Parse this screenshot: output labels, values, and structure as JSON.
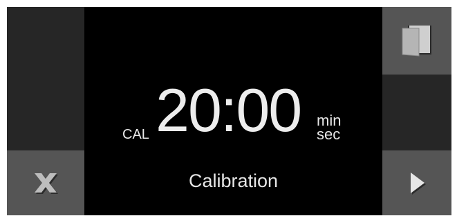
{
  "timer": {
    "prefix": "CAL",
    "value": "20:00",
    "unit_top": "min",
    "unit_bottom": "sec"
  },
  "mode": {
    "label": "Calibration"
  },
  "buttons": {
    "door_icon": "door-icon",
    "cancel_icon": "close-icon",
    "start_icon": "play-icon"
  },
  "colors": {
    "background": "#000000",
    "button": "#555555",
    "panel": "#262626",
    "text": "#e6e6e6"
  }
}
